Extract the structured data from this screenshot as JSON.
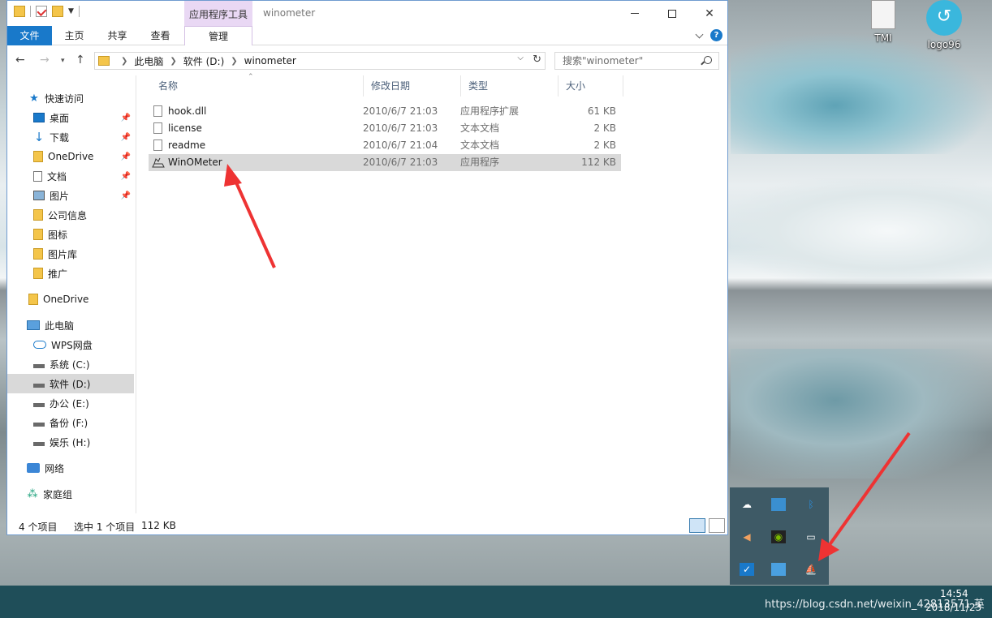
{
  "window": {
    "title": "winometer",
    "context_tab_group": "应用程序工具",
    "ribbon_tabs": [
      "文件",
      "主页",
      "共享",
      "查看",
      "管理"
    ],
    "help_glyph": "?"
  },
  "address": {
    "segments": [
      "此电脑",
      "软件 (D:)",
      "winometer"
    ],
    "search_placeholder": "搜索\"winometer\""
  },
  "nav": {
    "quick_access": "快速访问",
    "pinned": [
      "桌面",
      "下载",
      "OneDrive",
      "文档",
      "图片"
    ],
    "folders": [
      "公司信息",
      "图标",
      "图片库",
      "推广"
    ],
    "onedrive": "OneDrive",
    "this_pc": "此电脑",
    "pc_items": [
      "WPS网盘",
      "系统 (C:)",
      "软件 (D:)",
      "办公 (E:)",
      "备份 (F:)",
      "娱乐 (H:)"
    ],
    "network": "网络",
    "homegroup": "家庭组",
    "selected": "软件 (D:)"
  },
  "columns": [
    "名称",
    "修改日期",
    "类型",
    "大小"
  ],
  "files": [
    {
      "name": "hook.dll",
      "date": "2010/6/7 21:03",
      "type": "应用程序扩展",
      "size": "61 KB",
      "icon": "dll-file-icon"
    },
    {
      "name": "license",
      "date": "2010/6/7 21:03",
      "type": "文本文档",
      "size": "2 KB",
      "icon": "text-file-icon"
    },
    {
      "name": "readme",
      "date": "2010/6/7 21:04",
      "type": "文本文档",
      "size": "2 KB",
      "icon": "text-file-icon"
    },
    {
      "name": "WinOMeter",
      "date": "2010/6/7 21:03",
      "type": "应用程序",
      "size": "112 KB",
      "icon": "winometer-app-icon",
      "selected": true
    }
  ],
  "status": {
    "item_count": "4 个项目",
    "selection": "选中 1 个项目",
    "selection_size": "112 KB"
  },
  "desktop": {
    "icons": [
      {
        "label": "TMI",
        "icon": "document-icon"
      },
      {
        "label": "logo96",
        "icon": "logo-circle-icon"
      }
    ]
  },
  "tray_popup_icons": [
    "cloud-icon",
    "network-adapter-icon",
    "bluetooth-icon",
    "speaker-icon",
    "nvidia-icon",
    "battery-icon",
    "security-icon",
    "app-window-icon",
    "winometer-tray-icon"
  ],
  "taskbar": {
    "text": "https://blog.csdn.net/weixin_42813571 英",
    "time": "14:54",
    "date": "2018/11/23"
  },
  "colors": {
    "accent": "#1979ca",
    "context_tab": "#e9d8f4",
    "selection": "#d9d9d9",
    "annotation_arrow": "#ee3333",
    "taskbar": "#1f4e59"
  }
}
